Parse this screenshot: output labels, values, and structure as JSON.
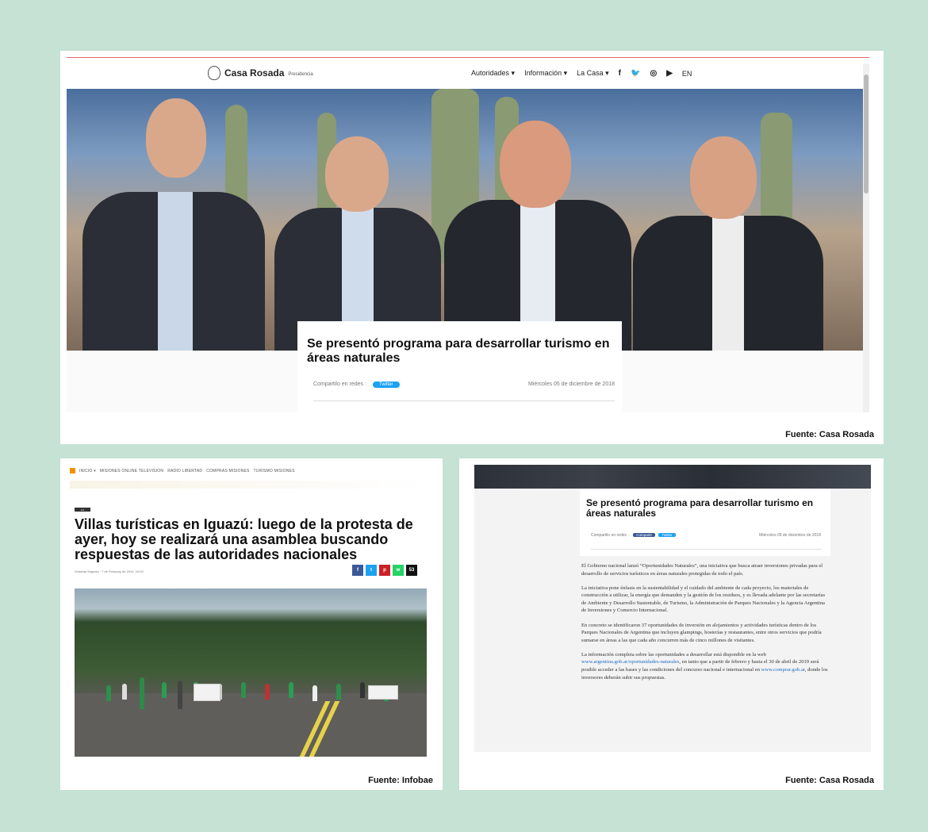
{
  "top": {
    "brand": {
      "name": "Casa Rosada",
      "sub": "Presidencia"
    },
    "nav": {
      "items": [
        "Autoridades ▾",
        "Información ▾",
        "La Casa ▾"
      ],
      "social": [
        "f",
        "🐦",
        "◎",
        "▶"
      ],
      "lang": "EN"
    },
    "article": {
      "title": "Se presentó programa para desarrollar turismo en áreas naturales",
      "share_label": "Compartilo en redes :",
      "twitter": "Twitter",
      "date": "Miércoles 05 de diciembre de 2018"
    },
    "caption": "Fuente: Casa Rosada"
  },
  "bottom_left": {
    "nav": [
      "INICIO ▾",
      "MISIONES ONLINE TELEVISION",
      "RADIO LIBERTAD",
      "COMPRAS MISIONES",
      "TURISMO MISIONES"
    ],
    "tag": "•••",
    "title": "Villas turísticas en Iguazú: luego de la protesta de ayer, hoy se realizará una asamblea buscando respuestas de las autoridades nacionales",
    "byline": "Griselda Segovia · 7 de February de 2019, 10:20",
    "share": [
      "f",
      "t",
      "p",
      "w",
      "53"
    ],
    "share_colors": [
      "#3b5998",
      "#1da1f2",
      "#cb2027",
      "#25d366",
      "#111111"
    ],
    "caption": "Fuente: Infobae"
  },
  "bottom_right": {
    "title": "Se presentó programa para desarrollar turismo en áreas naturales",
    "share_label": "Compartilo en redes :",
    "btn_compartir": "Compartir",
    "btn_twitter": "Twitter",
    "date": "Miércoles 05 de diciembre de 2018",
    "p1": "El Gobierno nacional lanzó “Oportunidades Naturales”, una iniciativa que busca atraer inversiones privadas para el desarrollo de servicios turísticos en áreas naturales protegidas de todo el país.",
    "p2": "La iniciativa pone énfasis en la sustentabilidad y el cuidado del ambiente de cada proyecto, los materiales de construcción a utilizar, la energía que demanden y la gestión de los residuos, y es llevada adelante por las secretarías de Ambiente y Desarrollo Sustentable, de Turismo, la Administración de Parques Nacionales y la Agencia Argentina de Inversiones y Comercio Internacional.",
    "p3": "En concreto se identificaron 37 oportunidades de inversión en alojamientos y actividades turísticas dentro de los Parques Nacionales de Argentina que incluyen glampings, hosterías y restaurantes, entre otros servicios que podría sumarse en áreas a las que cada año concurren más de cinco millones de visitantes.",
    "p4_a": "La información completa sobre las oportunidades a desarrollar está disponible en la web ",
    "p4_link1": "www.argentina.gob.ar/oportunidades-naturales",
    "p4_b": ", en tanto que a partir de febrero y hasta el 30 de abril de 2019 será posible acceder a las bases y las condiciones del concurso nacional e internacional en ",
    "p4_link2": "www.comprar.gob.ar",
    "p4_c": ", donde los inversores deberán subir sus propuestas.",
    "caption": "Fuente: Casa Rosada"
  }
}
